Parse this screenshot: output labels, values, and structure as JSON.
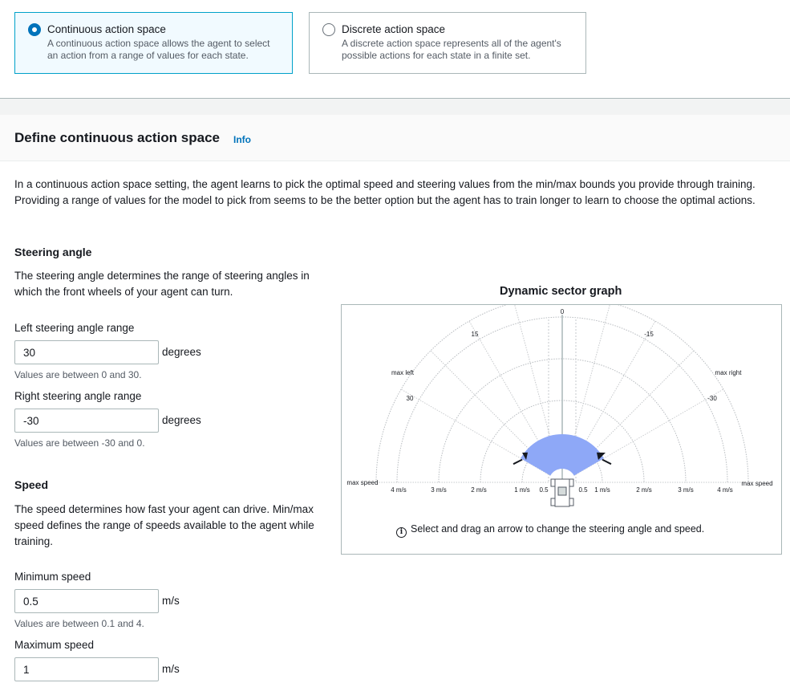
{
  "action_space": {
    "continuous": {
      "title": "Continuous action space",
      "description_line1": "A continuous action space allows the agent to select",
      "description_line2": "an action from a range of values for each state.",
      "selected": true
    },
    "discrete": {
      "title": "Discrete action space",
      "description_line1": "A discrete action space represents all of the agent's",
      "description_line2": "possible actions for each state in a finite set.",
      "selected": false
    }
  },
  "section": {
    "title": "Define continuous action space",
    "info_link": "Info",
    "intro": "In a continuous action space setting, the agent learns to pick the optimal speed and steering values from the min/max bounds you provide through training. Providing a range of values for the model to pick from seems to be the better option but the agent has to train longer to learn to choose the optimal actions."
  },
  "steering": {
    "heading": "Steering angle",
    "description": "The steering angle determines the range of steering angles in which the front wheels of your agent can turn.",
    "left": {
      "label": "Left steering angle range",
      "value": "30",
      "unit": "degrees",
      "hint": "Values are between 0 and 30."
    },
    "right": {
      "label": "Right steering angle range",
      "value": "-30",
      "unit": "degrees",
      "hint": "Values are between -30 and 0."
    }
  },
  "speed": {
    "heading": "Speed",
    "description": "The speed determines how fast your agent can drive. Min/max speed defines the range of speeds available to the agent while training.",
    "min": {
      "label": "Minimum speed",
      "value": "0.5",
      "unit": "m/s",
      "hint": "Values are between 0.1 and 4."
    },
    "max": {
      "label": "Maximum speed",
      "value": "1",
      "unit": "m/s"
    }
  },
  "graph": {
    "title": "Dynamic sector graph",
    "angle_labels": {
      "center": "0",
      "left_15": "15",
      "right_15": "-15",
      "left_30": "30",
      "right_30": "-30"
    },
    "max_left": "max left",
    "max_right": "max right",
    "max_speed": "max speed",
    "speed_labels_left": [
      "4 m/s",
      "3 m/s",
      "2 m/s",
      "1 m/s",
      "0.5"
    ],
    "speed_labels_right": [
      "0.5",
      "1 m/s",
      "2 m/s",
      "3 m/s",
      "4 m/s"
    ],
    "note": "Select and drag an arrow to change the steering angle and speed.",
    "sector": {
      "min_speed": 0.5,
      "max_speed": 1,
      "left_angle": 30,
      "right_angle": -30,
      "fill_color": "#8ea8f7"
    }
  }
}
